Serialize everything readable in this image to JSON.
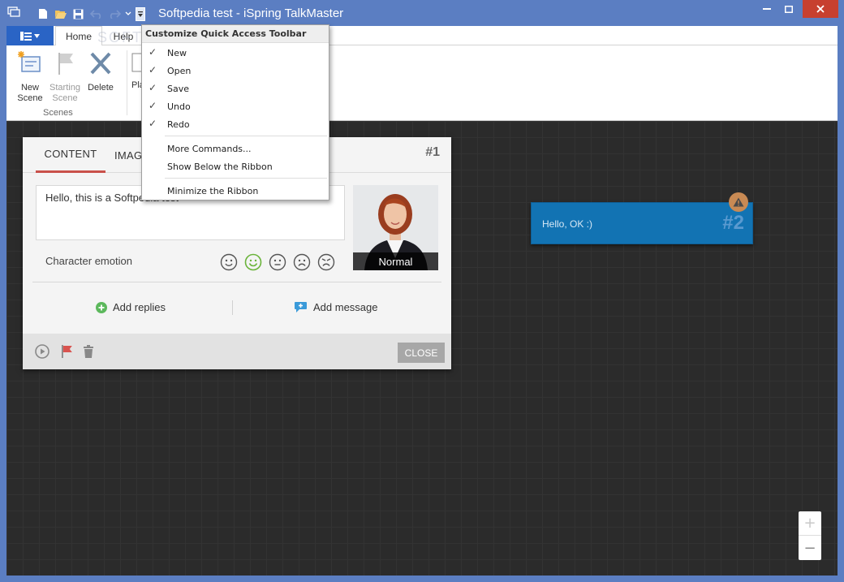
{
  "window": {
    "title": "Softpedia test - iSpring TalkMaster",
    "watermark": "SOFTPEDIA"
  },
  "quick_access": {
    "icons": [
      "new-icon",
      "open-icon",
      "save-icon",
      "undo-icon",
      "redo-icon",
      "customize-dropdown-icon"
    ]
  },
  "ribbon": {
    "tabs": [
      {
        "label": "Home"
      },
      {
        "label": "Help"
      }
    ],
    "buttons": [
      {
        "label": "New\nScene"
      },
      {
        "label": "Starting\nScene"
      },
      {
        "label": "Delete"
      }
    ],
    "group_label": "Scenes",
    "partial_button_label": "Pla"
  },
  "qat_menu": {
    "header": "Customize Quick Access Toolbar",
    "checked_items": [
      "New",
      "Open",
      "Save",
      "Undo",
      "Redo"
    ],
    "items": [
      "More Commands...",
      "Show Below the Ribbon",
      "Minimize the Ribbon"
    ]
  },
  "scene1": {
    "tabs": [
      "CONTENT",
      "IMAGE"
    ],
    "number": "#1",
    "message": "Hello, this is a Softpedia test",
    "character_state": "Normal",
    "emotion_label": "Character emotion",
    "emotions": [
      "neutral",
      "happy",
      "plain",
      "sad",
      "angry"
    ],
    "selected_emotion": "happy",
    "add_replies": "Add replies",
    "add_message": "Add message",
    "close": "CLOSE"
  },
  "scene2": {
    "text": "Hello, OK :)",
    "number": "#2"
  },
  "zoom": {
    "in": "+",
    "out": "−"
  },
  "colors": {
    "frame": "#5b7ec2",
    "file_tab": "#2a64c5",
    "accent_tab": "#c9504a",
    "scene2_bg": "#1273b3",
    "warning": "#c88a54",
    "close_btn": "#a7a7a7"
  }
}
